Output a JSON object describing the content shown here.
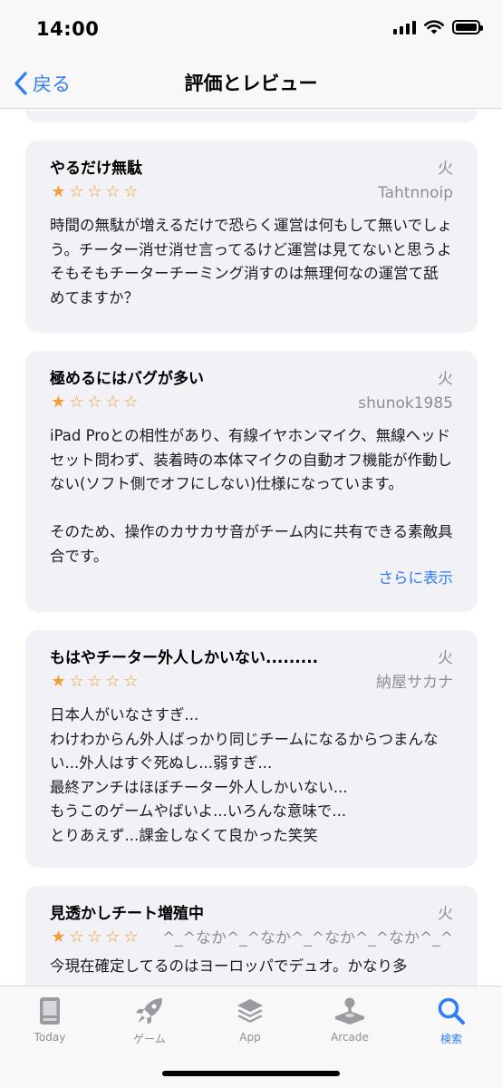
{
  "status": {
    "time": "14:00"
  },
  "nav": {
    "back_label": "戻る",
    "title": "評価とレビュー"
  },
  "reviews": [
    {
      "title": "やるだけ無駄",
      "date": "火",
      "author": "Tahtnnoip",
      "rating": 1,
      "body": "時間の無駄が増えるだけで恐らく運営は何もして無いでしょう。チーター消せ消せ言ってるけど運営は見てないと思うよそもそもチーターチーミング消すのは無理何なの運営て舐めてますか？"
    },
    {
      "title": "極めるにはバグが多い",
      "date": "火",
      "author": "shunok1985",
      "rating": 1,
      "body": "iPad Proとの相性があり、有線イヤホンマイク、無線ヘッドセット問わず、装着時の本体マイクの自動オフ機能が作動しない(ソフト側でオフにしない)仕様になっています。\n\nそのため、操作のカサカサ音がチーム内に共有できる素敵具合です。",
      "more_label": "さらに表示"
    },
    {
      "title": "もはやチーター外人しかいない.........",
      "date": "火",
      "author": "納屋サカナ",
      "rating": 1,
      "body": "日本人がいなさすぎ...\nわけわからん外人ばっかり同じチームになるからつまんない...外人はすぐ死ぬし...弱すぎ...\n最終アンチはほぼチーター外人しかいない...\nもうこのゲームやばいよ...いろんな意味で...\nとりあえず...課金しなくて良かった笑笑"
    },
    {
      "title": "見透かしチート増殖中",
      "date": "火",
      "author": "^_^なか^_^なか^_^なか^_^なか^_^",
      "rating": 1,
      "body": "今現在確定してるのはヨーロッパでデュオ。かなり多"
    }
  ],
  "tabs": [
    {
      "label": "Today",
      "icon": "today-icon",
      "active": false
    },
    {
      "label": "ゲーム",
      "icon": "rocket-icon",
      "active": false
    },
    {
      "label": "App",
      "icon": "layers-icon",
      "active": false
    },
    {
      "label": "Arcade",
      "icon": "joystick-icon",
      "active": false
    },
    {
      "label": "検索",
      "icon": "search-icon",
      "active": true
    }
  ],
  "colors": {
    "accent": "#2f7cf6",
    "star": "#f29d38",
    "card": "#f1f1f6",
    "secondary_text": "#8e8e93"
  }
}
